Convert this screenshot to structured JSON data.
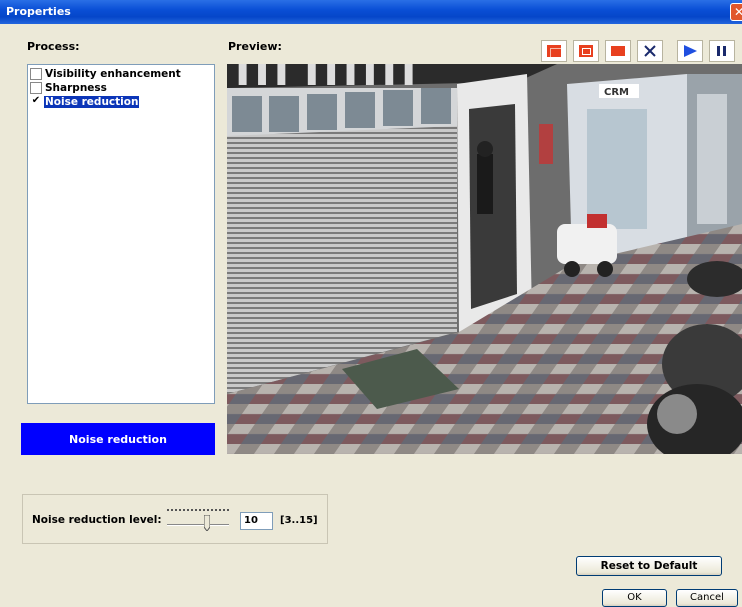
{
  "window": {
    "title": "Properties",
    "close_glyph": "✕"
  },
  "process": {
    "label": "Process:",
    "items": [
      {
        "label": "Visibility enhancement",
        "checked": false
      },
      {
        "label": "Sharpness",
        "checked": false
      },
      {
        "label": "Noise reduction",
        "checked": true,
        "selected": true
      }
    ],
    "check_glyph": "✔",
    "selected_name": "Noise reduction"
  },
  "preview": {
    "label": "Preview:",
    "toolbar": [
      {
        "icon": "split-vertical-icon"
      },
      {
        "icon": "split-horizontal-icon"
      },
      {
        "icon": "full-view-icon"
      },
      {
        "icon": "close-icon"
      },
      {
        "icon": "play-icon"
      },
      {
        "icon": "pause-icon"
      }
    ],
    "sign_text": "CRM"
  },
  "noise_reduction": {
    "label": "Noise reduction level:",
    "value": "10",
    "range": "[3..15]",
    "min": 3,
    "max": 15
  },
  "buttons": {
    "reset": "Reset to Default",
    "ok": "OK",
    "cancel": "Cancel"
  },
  "colors": {
    "accent_blue": "#0000ff",
    "selection_blue": "#0b35b8",
    "toolbar_red": "#e8401f",
    "toolbar_blue": "#1f4fe0"
  }
}
